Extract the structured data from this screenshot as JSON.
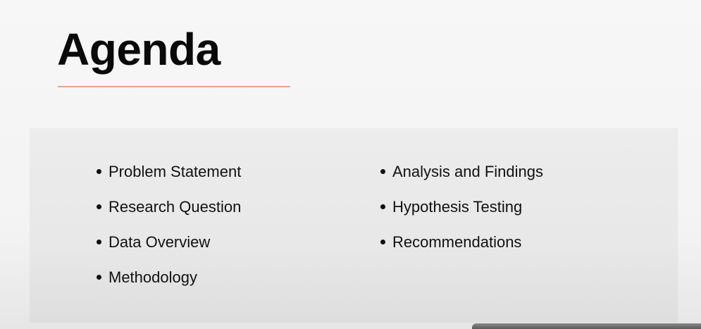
{
  "slide": {
    "title": "Agenda",
    "accent_color": "#eaa390",
    "left_column": [
      "Problem Statement",
      "Research Question",
      "Data Overview",
      "Methodology"
    ],
    "right_column": [
      "Analysis and Findings",
      "Hypothesis Testing",
      "Recommendations"
    ]
  }
}
